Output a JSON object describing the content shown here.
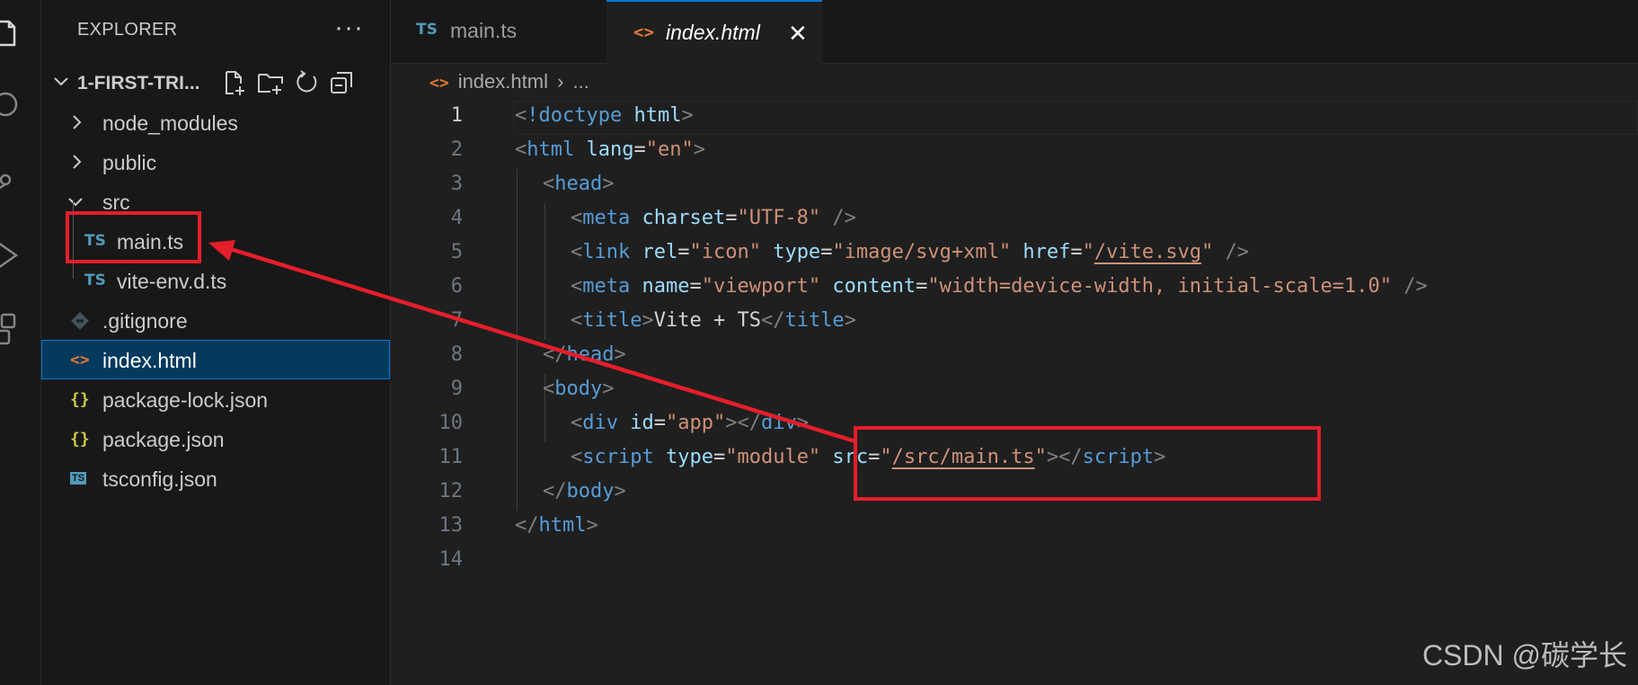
{
  "explorer": {
    "title": "EXPLORER",
    "more": "···",
    "workspace": "1-FIRST-TRI...",
    "items": [
      {
        "label": "node_modules",
        "kind": "folder",
        "expanded": false
      },
      {
        "label": "public",
        "kind": "folder",
        "expanded": false
      },
      {
        "label": "src",
        "kind": "folder",
        "expanded": true
      },
      {
        "label": "main.ts",
        "kind": "ts"
      },
      {
        "label": "vite-env.d.ts",
        "kind": "ts"
      },
      {
        "label": ".gitignore",
        "kind": "git"
      },
      {
        "label": "index.html",
        "kind": "html",
        "selected": true
      },
      {
        "label": "package-lock.json",
        "kind": "json"
      },
      {
        "label": "package.json",
        "kind": "json"
      },
      {
        "label": "tsconfig.json",
        "kind": "tsconfig"
      }
    ]
  },
  "icons": {
    "ts": "TS",
    "html": "<>",
    "json": "{}",
    "tsconfig": "TS"
  },
  "tabs": [
    {
      "label": "main.ts",
      "icon": "TS",
      "active": false
    },
    {
      "label": "index.html",
      "icon": "<>",
      "active": true,
      "close": "✕"
    }
  ],
  "breadcrumb": {
    "file": "index.html",
    "separator": "›",
    "rest": "..."
  },
  "editor": {
    "active_line": 1,
    "line_numbers": [
      "1",
      "2",
      "3",
      "4",
      "5",
      "6",
      "7",
      "8",
      "9",
      "10",
      "11",
      "12",
      "13",
      "14"
    ],
    "tokens": {
      "l1": [
        "<",
        "!doctype",
        " html",
        ">"
      ],
      "l2": [
        "<",
        "html",
        " lang",
        "=",
        "\"en\"",
        ">"
      ],
      "l3": [
        "<",
        "head",
        ">"
      ],
      "l4": [
        "<",
        "meta",
        " charset",
        "=",
        "\"UTF-8\"",
        " />"
      ],
      "l5": [
        "<",
        "link",
        " rel",
        "=",
        "\"icon\"",
        " type",
        "=",
        "\"image/svg+xml\"",
        " href",
        "=",
        "\"",
        "/vite.svg",
        "\"",
        " />"
      ],
      "l6": [
        "<",
        "meta",
        " name",
        "=",
        "\"viewport\"",
        " content",
        "=",
        "\"width=device-width, initial-scale=1.0\"",
        " />"
      ],
      "l7": [
        "<",
        "title",
        ">",
        "Vite + TS",
        "</",
        "title",
        ">"
      ],
      "l8": [
        "</",
        "head",
        ">"
      ],
      "l9": [
        "<",
        "body",
        ">"
      ],
      "l10": [
        "<",
        "div",
        " id",
        "=",
        "\"app\"",
        "></",
        "div",
        ">"
      ],
      "l11": [
        "<",
        "script",
        " type",
        "=",
        "\"module\"",
        " src",
        "=",
        "\"",
        "/src/main.ts",
        "\"",
        "></",
        "script",
        ">"
      ],
      "l12": [
        "</",
        "body",
        ">"
      ],
      "l13": [
        "</",
        "html",
        ">"
      ]
    }
  },
  "colors": {
    "annotation": "#e41e2b",
    "accent": "#0078d4",
    "tag": "#569cd6",
    "attr": "#9cdcfe",
    "string": "#ce9178"
  },
  "watermark": "CSDN @碳学长"
}
